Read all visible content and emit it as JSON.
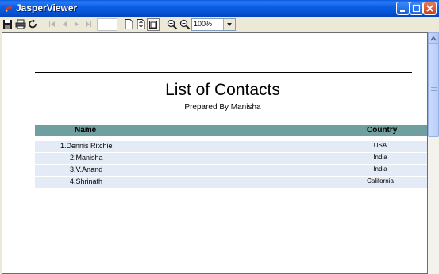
{
  "window": {
    "title": "JasperViewer"
  },
  "toolbar": {
    "icons": [
      "save-icon",
      "print-icon",
      "reload-icon",
      "first-page-icon",
      "previous-page-icon",
      "next-page-icon",
      "last-page-icon",
      "actual-size-icon",
      "fit-page-icon",
      "fit-width-icon",
      "zoom-in-icon",
      "zoom-out-icon"
    ],
    "page_number": "",
    "zoom_value": "100%"
  },
  "report": {
    "title": "List of Contacts",
    "subtitle": "Prepared By Manisha",
    "columns": {
      "name": "Name",
      "country": "Country"
    },
    "rows": [
      {
        "name": "1.Dennis Ritchie",
        "country": "USA"
      },
      {
        "name": "2.Manisha",
        "country": "India"
      },
      {
        "name": "3.V.Anand",
        "country": "India"
      },
      {
        "name": "4.Shrinath",
        "country": "California"
      }
    ]
  },
  "colors": {
    "titlebar": "#0a5ae0",
    "header_bg": "#6f9f9f",
    "row_bg": "#e2ebf6"
  }
}
